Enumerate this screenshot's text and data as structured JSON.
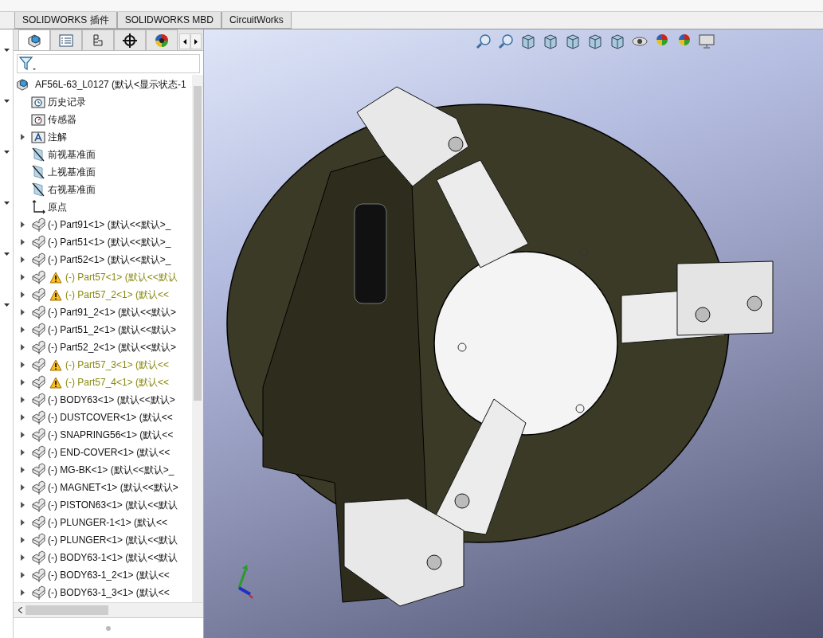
{
  "ribbon_tabs": [
    {
      "label": "SOLIDWORKS 插件"
    },
    {
      "label": "SOLIDWORKS MBD"
    },
    {
      "label": "CircuitWorks"
    }
  ],
  "panel_tabs": [
    {
      "kind": "feature",
      "selected": true
    },
    {
      "kind": "property",
      "selected": false
    },
    {
      "kind": "config",
      "selected": false
    },
    {
      "kind": "dimxpert",
      "selected": false
    },
    {
      "kind": "display",
      "selected": false
    }
  ],
  "tree": {
    "label": "AF56L-63_L0127  (默认<显示状态-1",
    "children": [
      {
        "kind": "history",
        "label": "历史记录",
        "expandable": false,
        "warning": false
      },
      {
        "kind": "sensor",
        "label": "传感器",
        "expandable": false,
        "warning": false
      },
      {
        "kind": "annotation",
        "label": "注解",
        "expandable": true,
        "warning": false
      },
      {
        "kind": "plane",
        "label": "前视基准面",
        "expandable": false,
        "warning": false
      },
      {
        "kind": "plane",
        "label": "上视基准面",
        "expandable": false,
        "warning": false
      },
      {
        "kind": "plane",
        "label": "右视基准面",
        "expandable": false,
        "warning": false
      },
      {
        "kind": "origin",
        "label": "原点",
        "expandable": false,
        "warning": false
      },
      {
        "kind": "part",
        "label": "(-) Part91<1>  (默认<<默认>_",
        "expandable": true,
        "warning": false
      },
      {
        "kind": "part",
        "label": "(-) Part51<1>  (默认<<默认>_",
        "expandable": true,
        "warning": false
      },
      {
        "kind": "part",
        "label": "(-) Part52<1>  (默认<<默认>_",
        "expandable": true,
        "warning": false
      },
      {
        "kind": "part",
        "label": "(-) Part57<1>  (默认<<默认",
        "expandable": true,
        "warning": true
      },
      {
        "kind": "part",
        "label": "(-) Part57_2<1>  (默认<<",
        "expandable": true,
        "warning": true
      },
      {
        "kind": "part",
        "label": "(-) Part91_2<1>  (默认<<默认>",
        "expandable": true,
        "warning": false
      },
      {
        "kind": "part",
        "label": "(-) Part51_2<1>  (默认<<默认>",
        "expandable": true,
        "warning": false
      },
      {
        "kind": "part",
        "label": "(-) Part52_2<1>  (默认<<默认>",
        "expandable": true,
        "warning": false
      },
      {
        "kind": "part",
        "label": "(-) Part57_3<1>  (默认<<",
        "expandable": true,
        "warning": true
      },
      {
        "kind": "part",
        "label": "(-) Part57_4<1>  (默认<<",
        "expandable": true,
        "warning": true
      },
      {
        "kind": "part",
        "label": "(-) BODY63<1>  (默认<<默认>",
        "expandable": true,
        "warning": false
      },
      {
        "kind": "part",
        "label": "(-) DUSTCOVER<1>  (默认<<",
        "expandable": true,
        "warning": false
      },
      {
        "kind": "part",
        "label": "(-) SNAPRING56<1>  (默认<<",
        "expandable": true,
        "warning": false
      },
      {
        "kind": "part",
        "label": "(-) END-COVER<1>  (默认<<",
        "expandable": true,
        "warning": false
      },
      {
        "kind": "part",
        "label": "(-) MG-BK<1>  (默认<<默认>_",
        "expandable": true,
        "warning": false
      },
      {
        "kind": "part",
        "label": "(-) MAGNET<1>  (默认<<默认>",
        "expandable": true,
        "warning": false
      },
      {
        "kind": "part",
        "label": "(-) PISTON63<1>  (默认<<默认",
        "expandable": true,
        "warning": false
      },
      {
        "kind": "part",
        "label": "(-) PLUNGER-1<1>  (默认<<",
        "expandable": true,
        "warning": false
      },
      {
        "kind": "part",
        "label": "(-) PLUNGER<1>  (默认<<默认",
        "expandable": true,
        "warning": false
      },
      {
        "kind": "part",
        "label": "(-) BODY63-1<1>  (默认<<默认",
        "expandable": true,
        "warning": false
      },
      {
        "kind": "part",
        "label": "(-) BODY63-1_2<1>  (默认<<",
        "expandable": true,
        "warning": false
      },
      {
        "kind": "part",
        "label": "(-) BODY63-1_3<1>  (默认<<",
        "expandable": true,
        "warning": false
      }
    ]
  }
}
